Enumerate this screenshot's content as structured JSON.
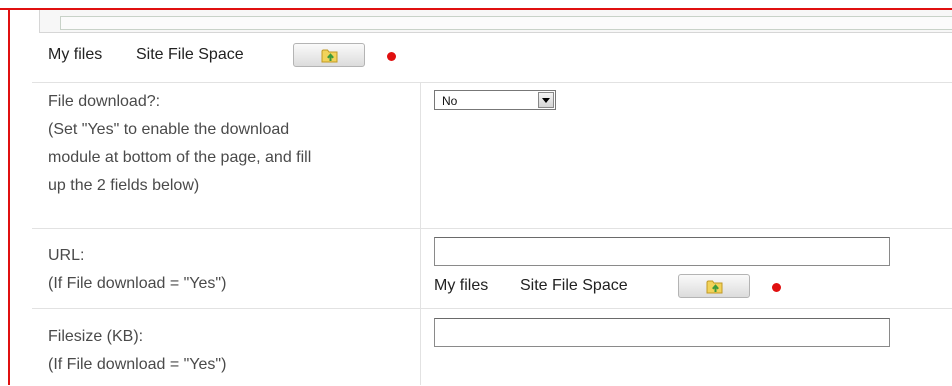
{
  "files_bar_1": {
    "my_files": "My files",
    "site_file_space": "Site File Space",
    "button_icon": "folder-upload-icon"
  },
  "download": {
    "label": "File download?:",
    "help_1": "(Set \"Yes\" to enable the download",
    "help_2": "module at bottom of the page, and fill",
    "help_3": "up the 2 fields below)",
    "select_value": "No"
  },
  "url": {
    "label": "URL:",
    "help": "(If File download = \"Yes\")",
    "value": ""
  },
  "files_bar_2": {
    "my_files": "My files",
    "site_file_space": "Site File Space",
    "button_icon": "folder-upload-icon"
  },
  "filesize": {
    "label": "Filesize (KB):",
    "help": "(If File download = \"Yes\")",
    "value": ""
  },
  "colors": {
    "required_marker": "#e01010",
    "frame_border": "#e01010",
    "text": "#4a4a4a"
  }
}
